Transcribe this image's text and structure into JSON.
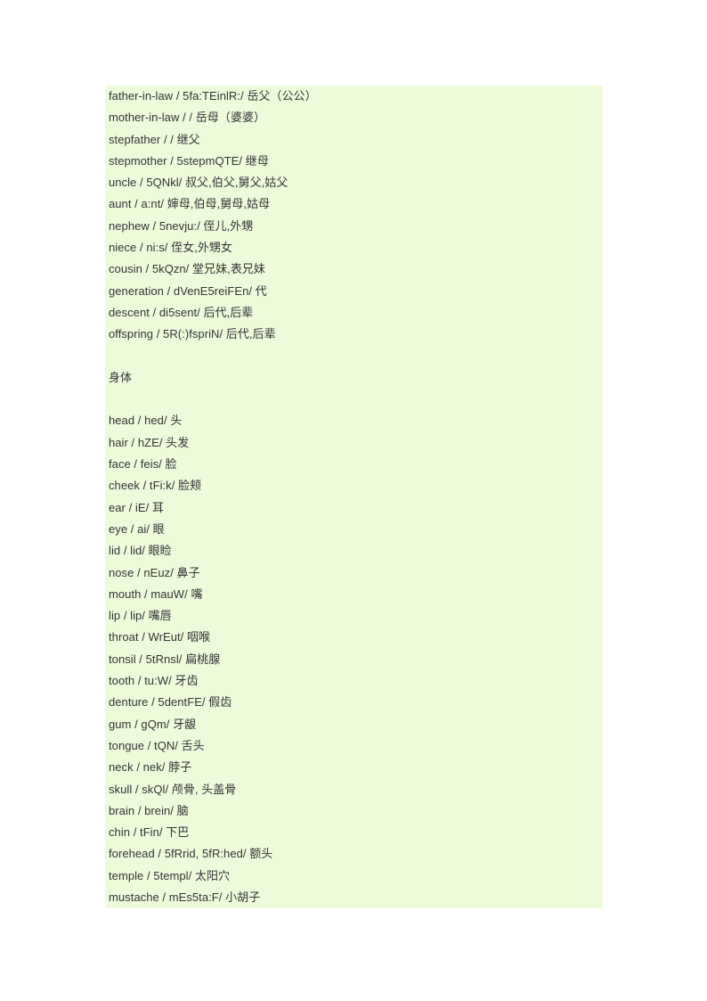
{
  "page": {
    "background_color": "#ffffff",
    "content_background_color": "#eefbdb",
    "text_color": "#333333"
  },
  "content": {
    "lines": [
      {
        "type": "entry",
        "text": "father-in-law / 5fa:TEinlR:/ 岳父（公公）"
      },
      {
        "type": "entry",
        "text": "mother-in-law / / 岳母（婆婆）"
      },
      {
        "type": "entry",
        "text": "stepfather / / 继父"
      },
      {
        "type": "entry",
        "text": "stepmother / 5stepmQTE/ 继母"
      },
      {
        "type": "entry",
        "text": "uncle / 5QNkl/ 叔父,伯父,舅父,姑父"
      },
      {
        "type": "entry",
        "text": "aunt / a:nt/ 婶母,伯母,舅母,姑母"
      },
      {
        "type": "entry",
        "text": "nephew / 5nevju:/ 侄儿,外甥"
      },
      {
        "type": "entry",
        "text": "niece / ni:s/ 侄女,外甥女"
      },
      {
        "type": "entry",
        "text": "cousin / 5kQzn/ 堂兄妹,表兄妹"
      },
      {
        "type": "entry",
        "text": "generation / dVenE5reiFEn/ 代"
      },
      {
        "type": "entry",
        "text": "descent / di5sent/ 后代,后辈"
      },
      {
        "type": "entry",
        "text": "offspring / 5R(:)fspriN/ 后代,后辈"
      },
      {
        "type": "blank",
        "text": ""
      },
      {
        "type": "heading",
        "text": "身体"
      },
      {
        "type": "blank",
        "text": ""
      },
      {
        "type": "entry",
        "text": "head / hed/ 头"
      },
      {
        "type": "entry",
        "text": "hair / hZE/ 头发"
      },
      {
        "type": "entry",
        "text": "face / feis/ 脸"
      },
      {
        "type": "entry",
        "text": "cheek / tFi:k/ 脸颊"
      },
      {
        "type": "entry",
        "text": "ear / iE/ 耳"
      },
      {
        "type": "entry",
        "text": "eye / ai/ 眼"
      },
      {
        "type": "entry",
        "text": "lid / lid/ 眼睑"
      },
      {
        "type": "entry",
        "text": "nose / nEuz/ 鼻子"
      },
      {
        "type": "entry",
        "text": "mouth / mauW/ 嘴"
      },
      {
        "type": "entry",
        "text": "lip / lip/ 嘴唇"
      },
      {
        "type": "entry",
        "text": "throat / WrEut/ 咽喉"
      },
      {
        "type": "entry",
        "text": "tonsil / 5tRnsl/ 扁桃腺"
      },
      {
        "type": "entry",
        "text": "tooth / tu:W/ 牙齿"
      },
      {
        "type": "entry",
        "text": "denture / 5dentFE/ 假齿"
      },
      {
        "type": "entry",
        "text": "gum / gQm/ 牙龈"
      },
      {
        "type": "entry",
        "text": "tongue / tQN/ 舌头"
      },
      {
        "type": "entry",
        "text": "neck / nek/ 脖子"
      },
      {
        "type": "entry",
        "text": "skull / skQl/ 颅骨, 头盖骨"
      },
      {
        "type": "entry",
        "text": "brain / brein/ 脑"
      },
      {
        "type": "entry",
        "text": "chin / tFin/ 下巴"
      },
      {
        "type": "entry",
        "text": "forehead / 5fRrid, 5fR:hed/ 额头"
      },
      {
        "type": "entry",
        "text": "temple / 5templ/ 太阳穴"
      },
      {
        "type": "entry",
        "text": "mustache / mEs5ta:F/ 小胡子"
      }
    ]
  }
}
